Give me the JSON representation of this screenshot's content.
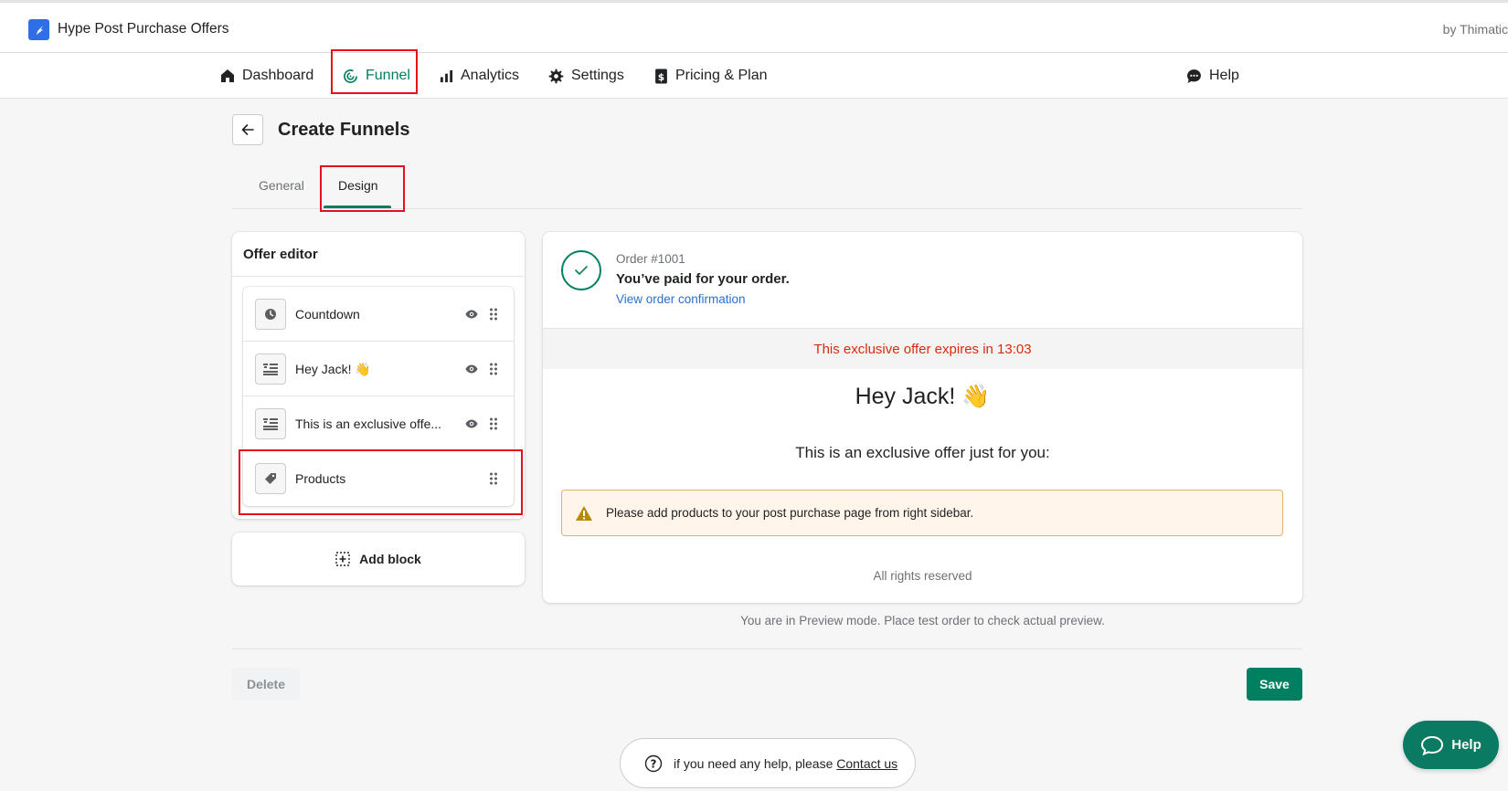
{
  "app": {
    "title": "Hype Post Purchase Offers",
    "by": "by Thimatic"
  },
  "nav": {
    "dashboard": "Dashboard",
    "funnel": "Funnel",
    "analytics": "Analytics",
    "settings": "Settings",
    "pricing": "Pricing & Plan",
    "help": "Help"
  },
  "page": {
    "title": "Create Funnels"
  },
  "tabs": {
    "general": "General",
    "design": "Design"
  },
  "editor": {
    "title": "Offer editor",
    "blocks": [
      {
        "label": "Countdown",
        "icon": "clock-icon"
      },
      {
        "label": "Hey Jack! 👋",
        "icon": "text-block-icon"
      },
      {
        "label": "This is an exclusive offe...",
        "icon": "text-block-icon"
      },
      {
        "label": "Products",
        "icon": "tag-icon"
      }
    ],
    "add_block": "Add block"
  },
  "preview": {
    "order_number": "Order #1001",
    "paid_text": "You’ve paid for your order.",
    "confirmation_link": "View order confirmation",
    "countdown_text": "This exclusive offer expires in 13:03",
    "greeting": "Hey Jack! 👋",
    "offer_text": "This is an exclusive offer just for you:",
    "warning": "Please add products to your post purchase page from right sidebar.",
    "rights": "All rights reserved"
  },
  "preview_note": "You are in Preview mode. Place test order to check actual preview.",
  "actions": {
    "delete": "Delete",
    "save": "Save"
  },
  "footer_help": {
    "text": "if you need any help, please",
    "link": "Contact us"
  },
  "help_fab": "Help",
  "colors": {
    "accent": "#008060",
    "danger": "#d72c0d",
    "link": "#2c6ecb",
    "highlight": "#e5101a",
    "warning_bg": "#fff5ea"
  }
}
